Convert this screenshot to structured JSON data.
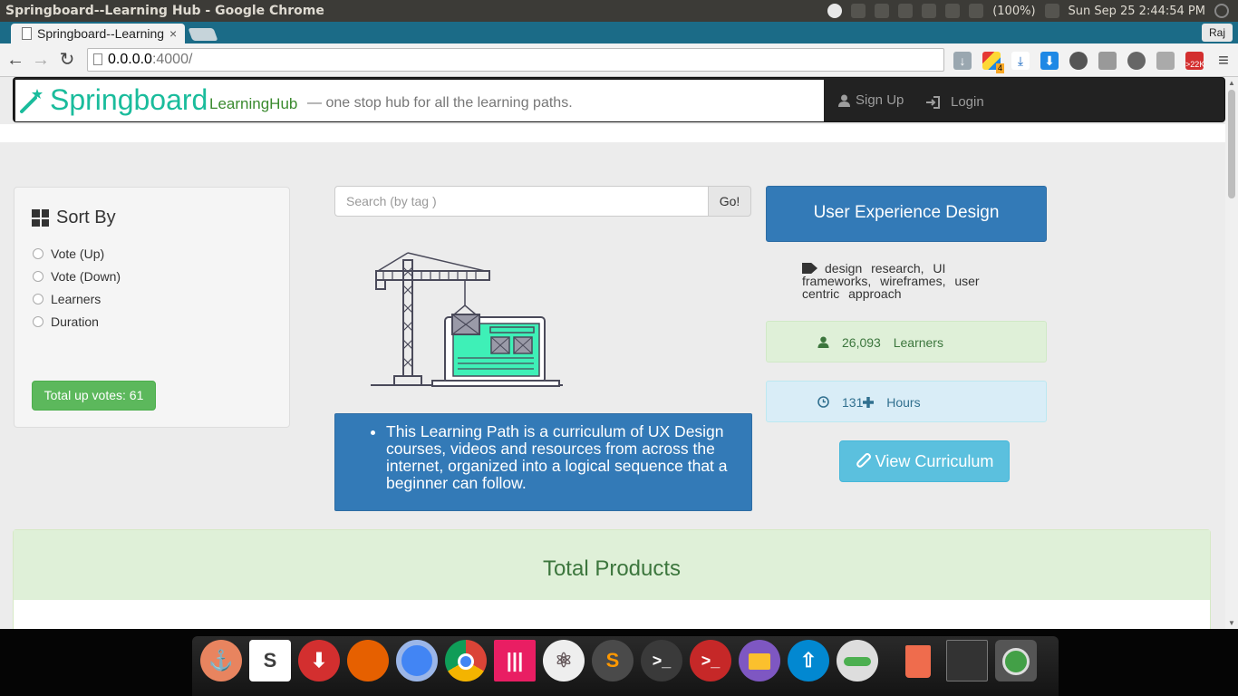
{
  "os": {
    "window_title": "Springboard--Learning Hub - Google Chrome",
    "battery": "(100%)",
    "clock": "Sun Sep 25  2:44:54 PM"
  },
  "browser": {
    "tab_title": "Springboard--Learning Hub",
    "tab_close": "×",
    "user": "Raj",
    "url_host": "0.0.0.0",
    "url_rest": ":4000/",
    "ext_badge_1": "4",
    "ext_badge_2": ">22K"
  },
  "navbar": {
    "brand": "Springboard",
    "brand_sub": "LearningHub",
    "tagline": "— one stop hub for all the learning paths.",
    "signup": "Sign Up",
    "login": "Login"
  },
  "sort": {
    "title": "Sort By",
    "options": [
      "Vote (Up)",
      "Vote (Down)",
      "Learners",
      "Duration"
    ],
    "votes_label": "Total up votes: 61"
  },
  "search": {
    "placeholder": "Search (by tag )",
    "button": "Go!"
  },
  "path": {
    "title": "User Experience Design",
    "tags": "design research, UI frameworks, wireframes, user centric approach",
    "learners_count": "26,093",
    "learners_label": "Learners",
    "hours_count": "131",
    "hours_label": "Hours",
    "view_button": "View Curriculum",
    "description": "This Learning Path is a curriculum of UX Design courses, videos and resources from across the internet, organized into a logical sequence that a beginner can follow."
  },
  "products": {
    "title": "Total Products"
  },
  "colors": {
    "brand": "#1abc9c",
    "primary": "#337ab7",
    "success": "#5cb85c",
    "info": "#5bc0de"
  },
  "dock": [
    "anchor-icon",
    "slack-icon",
    "downloader-icon",
    "firefox-icon",
    "chromium-icon",
    "chrome-icon",
    "gitkraken-icon",
    "atom-icon",
    "sublime-icon",
    "terminal-icon",
    "terminal-red-icon",
    "files-icon",
    "updater-icon",
    "toggle-icon",
    "trash-icon",
    "workspaces-icon",
    "monitor-icon"
  ]
}
